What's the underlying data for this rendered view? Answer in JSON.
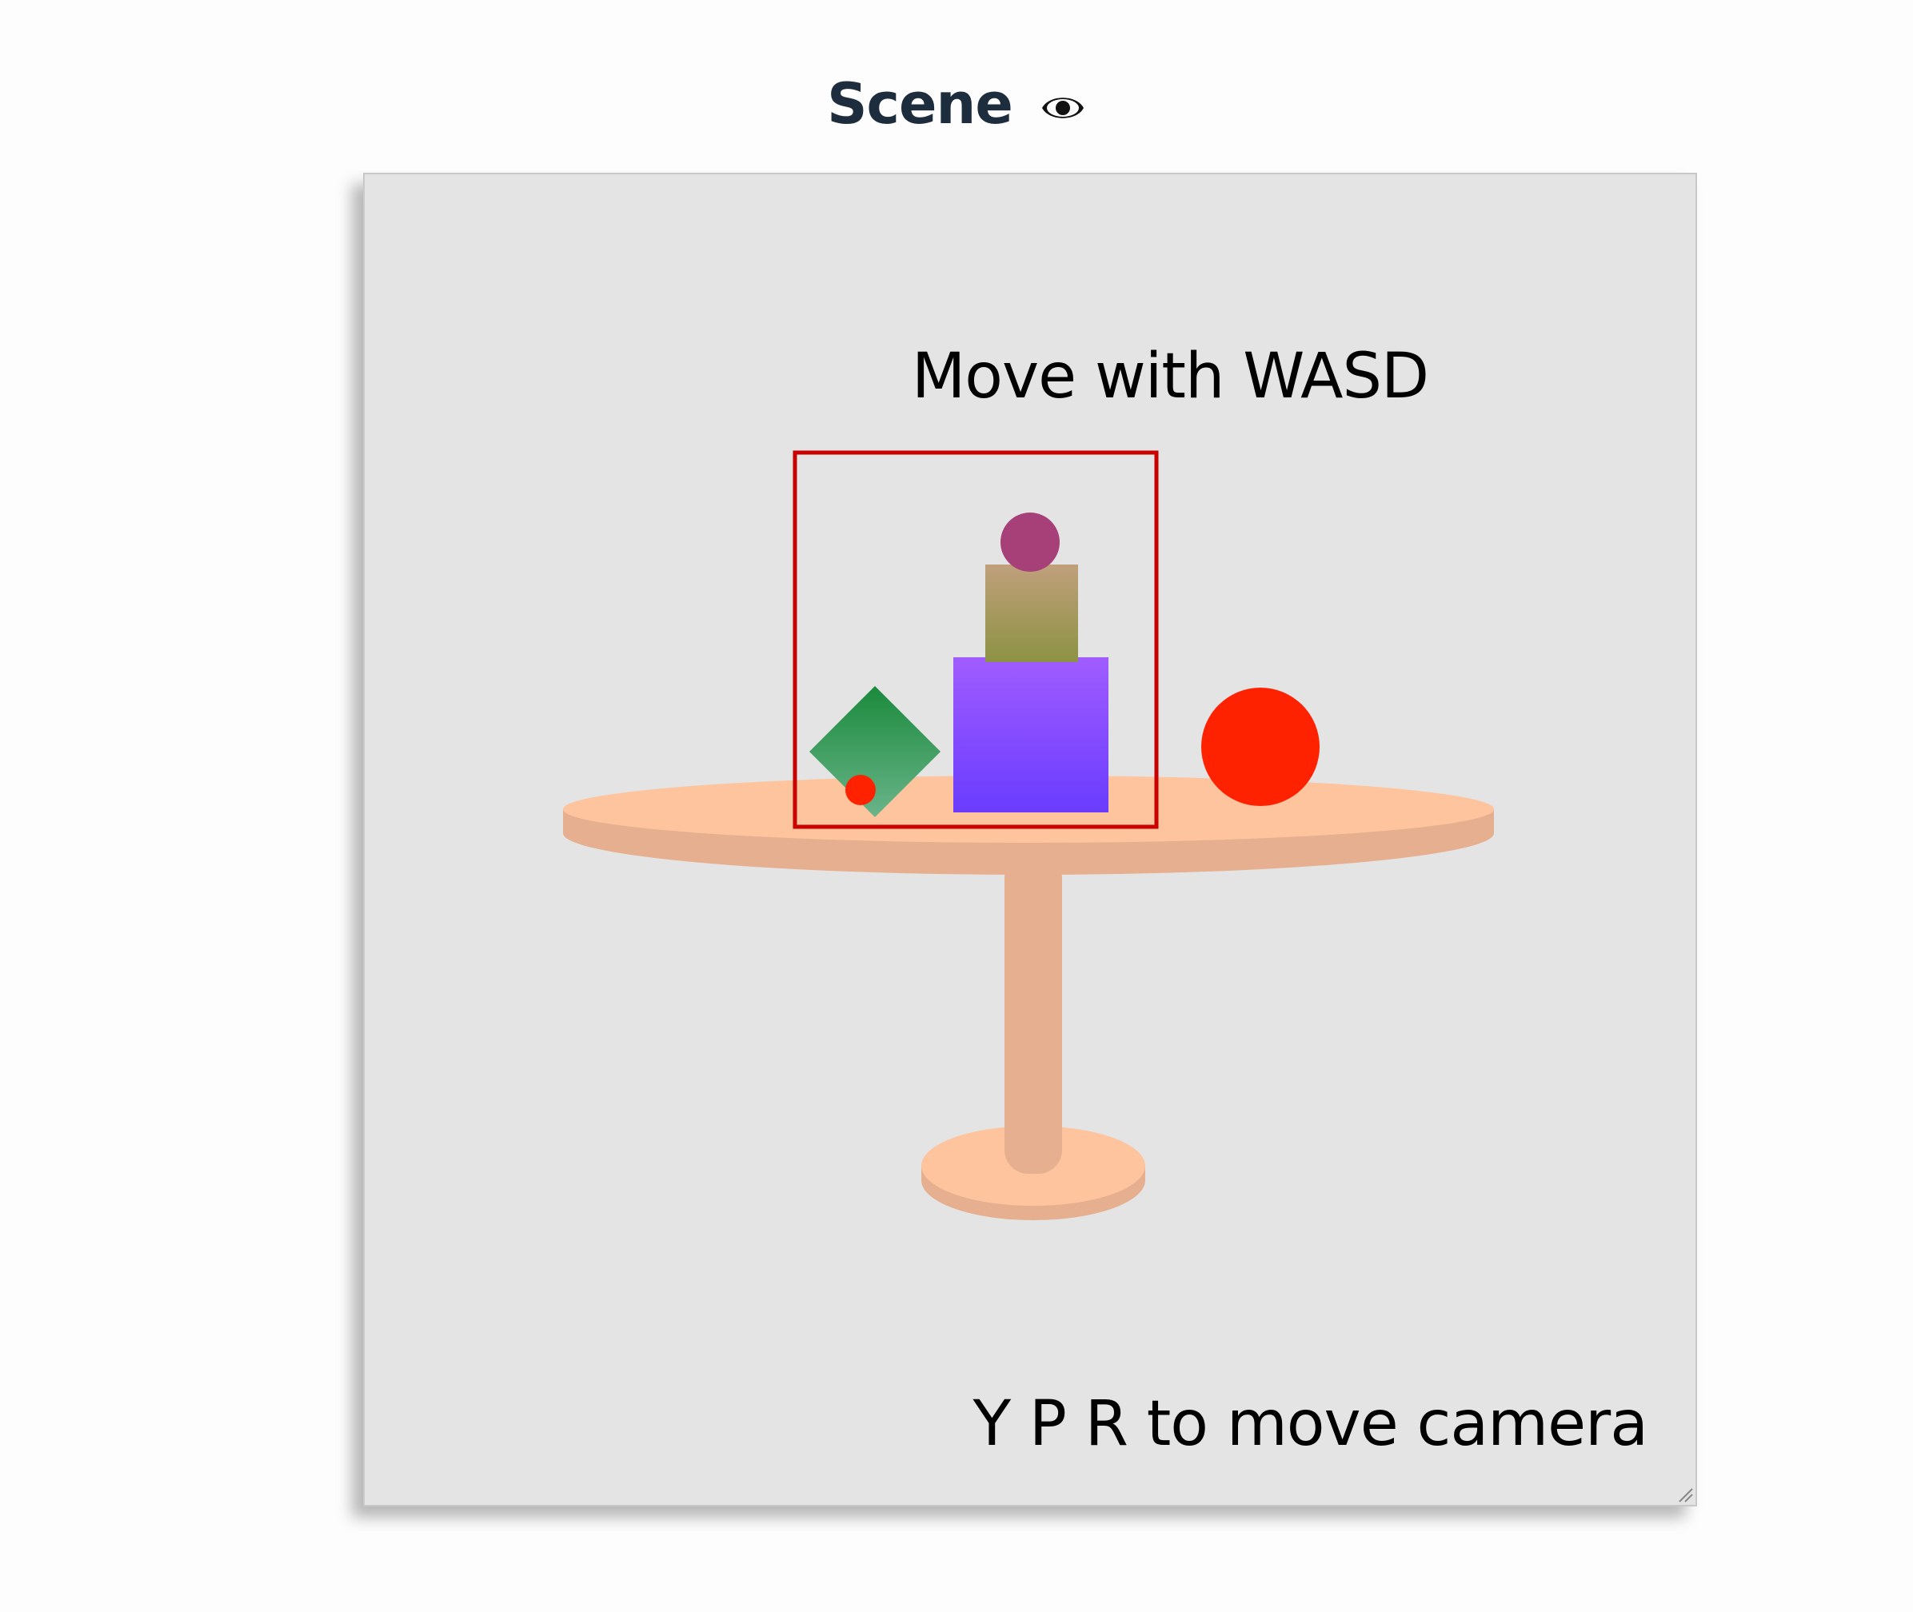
{
  "header": {
    "title": "Scene",
    "visibility_icon": "eye-icon"
  },
  "viewport": {
    "hints": {
      "move": "Move with WASD",
      "camera": "Y P R to move camera"
    },
    "background_color": "#e4e4e4",
    "objects": [
      {
        "name": "table",
        "color": "#fdc49e"
      },
      {
        "name": "purple-box",
        "color": "#8c52ff"
      },
      {
        "name": "olive-box",
        "color": "#a8a060"
      },
      {
        "name": "magenta-sphere",
        "color": "#a73f78"
      },
      {
        "name": "green-diamond",
        "color": "#2e9455"
      },
      {
        "name": "small-red-sphere",
        "color": "#ff2200"
      },
      {
        "name": "large-red-sphere",
        "color": "#ff2200"
      }
    ],
    "selection_color": "#c80000"
  }
}
